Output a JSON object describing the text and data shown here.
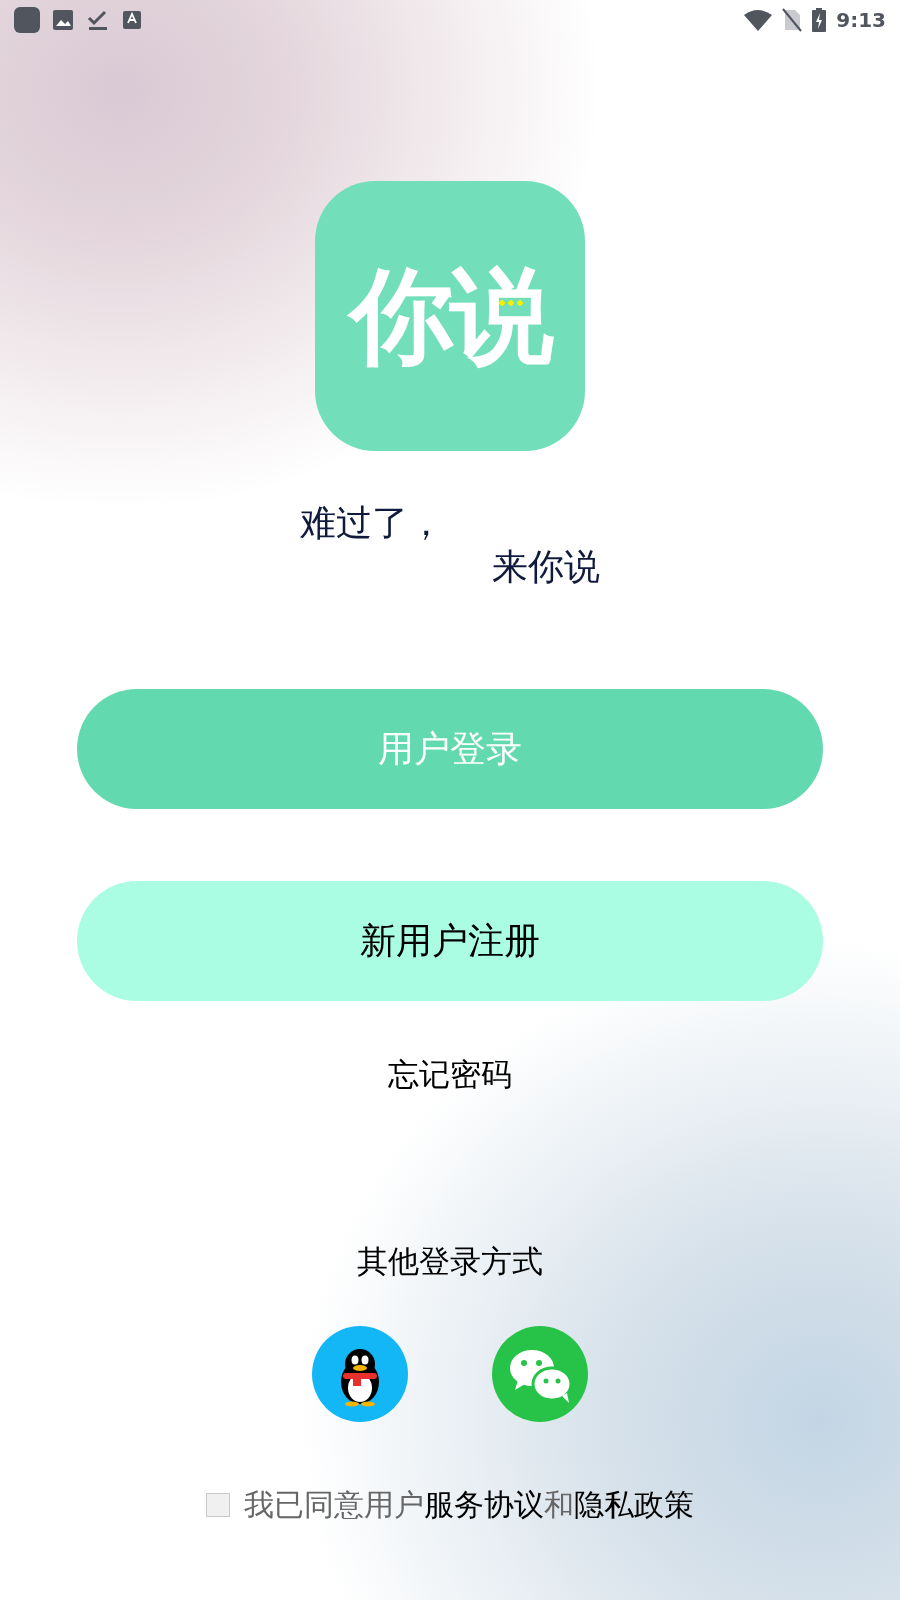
{
  "status_bar": {
    "time": "9:13"
  },
  "logo": {
    "text": "你说"
  },
  "tagline": [
    "难过了，",
    "来你说"
  ],
  "buttons": [
    {
      "kind": "primary",
      "label": "用户登录"
    },
    {
      "kind": "secondary",
      "label": "新用户注册"
    }
  ],
  "forgot_password": "忘记密码",
  "other_login": {
    "title": "其他登录方式",
    "methods": [
      {
        "kind": "qq"
      },
      {
        "kind": "wechat"
      }
    ]
  },
  "agreement": {
    "checked": false,
    "parts": [
      {
        "kind": "text",
        "text": "我已同意用户"
      },
      {
        "kind": "link",
        "text": "服务协议"
      },
      {
        "kind": "text",
        "text": "和"
      },
      {
        "kind": "link",
        "text": "隐私政策"
      }
    ]
  }
}
